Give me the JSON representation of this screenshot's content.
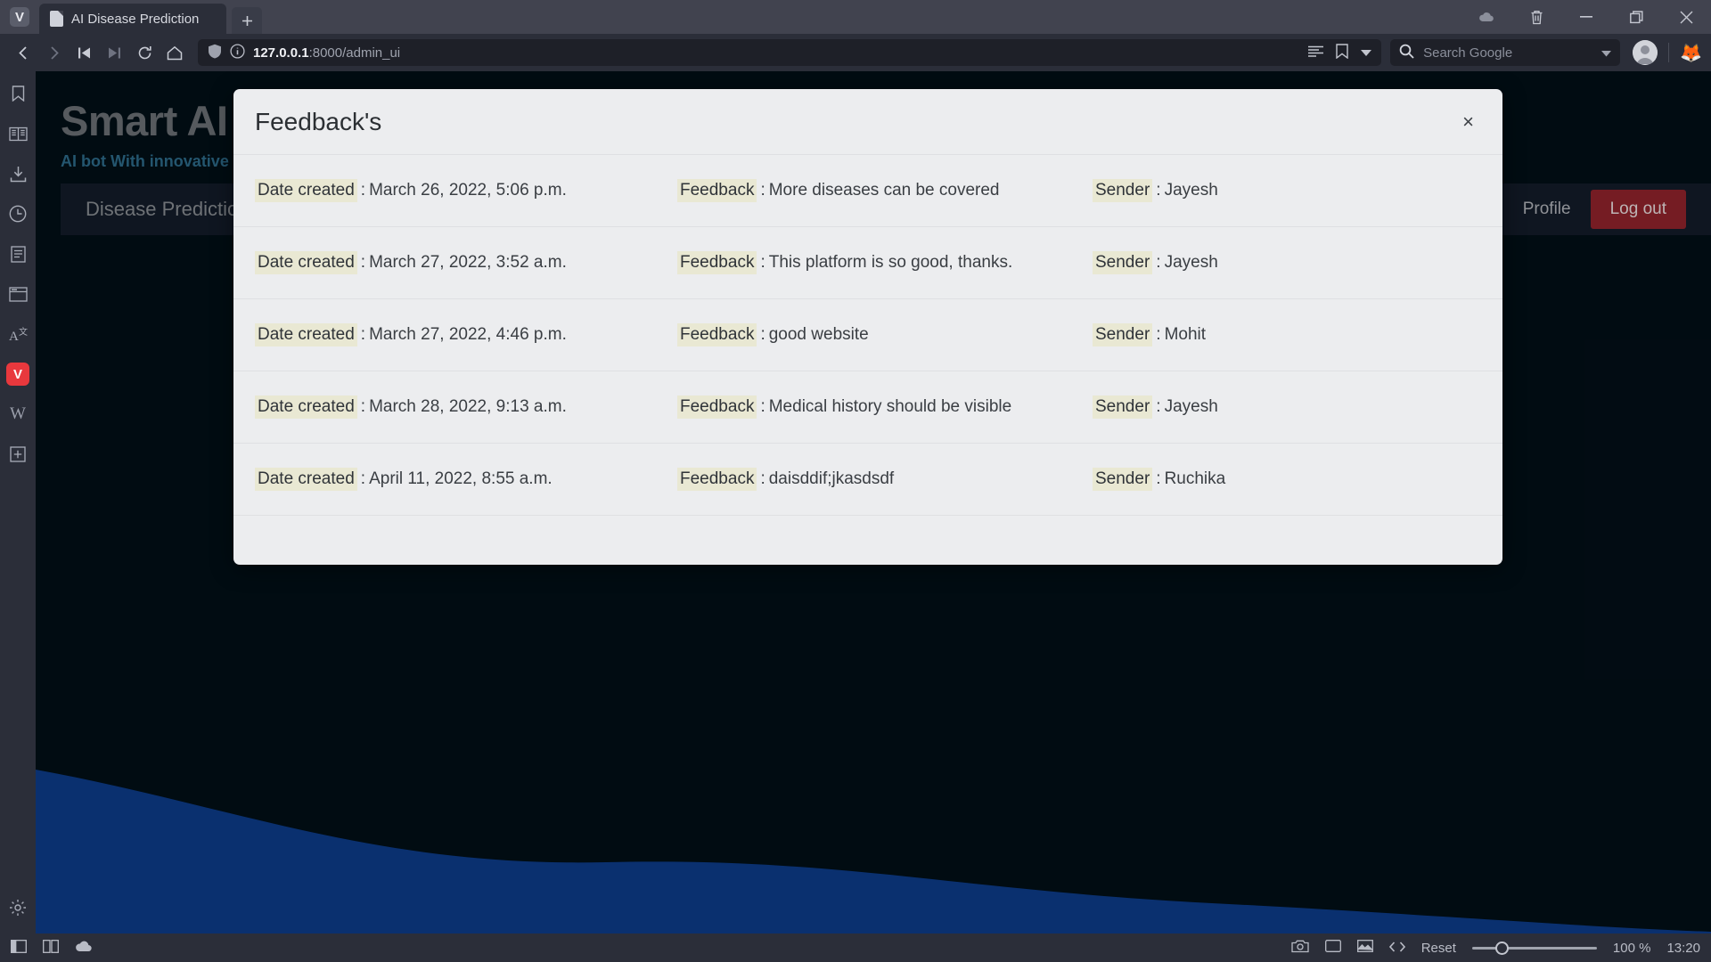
{
  "browser": {
    "app_icon": "vivaldi-logo",
    "tab": {
      "title": "AI Disease Prediction",
      "favicon": "page-icon"
    },
    "new_tab_label": "+",
    "window_controls": {
      "cloud": "cloud-icon",
      "trash": "trash-icon",
      "minimize": "minimize-icon",
      "maximize": "maximize-icon",
      "close": "close-icon"
    },
    "nav": {
      "back": "back-icon",
      "forward": "forward-icon",
      "rewind": "rewind-icon",
      "fastforward": "fastforward-icon",
      "reload": "reload-icon",
      "home": "home-icon"
    },
    "url": {
      "host": "127.0.0.1",
      "rest": ":8000/admin_ui",
      "shield": "shield-icon",
      "info": "info-icon"
    },
    "url_actions": {
      "reader": "reader-view-icon",
      "bookmark": "bookmark-icon",
      "chevron": "chevron-down-icon"
    },
    "search": {
      "placeholder": "Search Google",
      "icon": "search-icon",
      "chevron": "chevron-down-icon"
    },
    "extension": "firefox-metamask-icon"
  },
  "sidebar": {
    "items": [
      {
        "name": "bookmarks",
        "icon": "bookmark-icon"
      },
      {
        "name": "reading-list",
        "icon": "book-icon"
      },
      {
        "name": "downloads",
        "icon": "download-icon"
      },
      {
        "name": "history",
        "icon": "clock-icon"
      },
      {
        "name": "notes",
        "icon": "notes-icon"
      },
      {
        "name": "window-panel",
        "icon": "window-icon"
      },
      {
        "name": "translate",
        "icon": "translate-icon"
      },
      {
        "name": "vivaldi-panel",
        "icon": "vivaldi-icon",
        "label": "V",
        "active": true
      },
      {
        "name": "wikipedia-panel",
        "icon": "wikipedia-icon",
        "label": "W"
      },
      {
        "name": "add-panel",
        "icon": "plus-icon"
      }
    ],
    "settings": {
      "name": "settings",
      "icon": "gear-icon"
    }
  },
  "page": {
    "hero_title": "Smart AI",
    "hero_subtitle": "AI bot With innovative",
    "nav_link": "Disease Prediction",
    "profile_link": "Profile",
    "logout_label": "Log out",
    "wave_color": "#0d3e8f",
    "bg_color": "#021018"
  },
  "modal": {
    "title": "Feedback's",
    "close_label": "×",
    "labels": {
      "date": "Date created",
      "feedback": "Feedback",
      "sender": "Sender"
    },
    "separator": ":",
    "highlight_color": "#e9e8d3",
    "rows": [
      {
        "date": "March 26, 2022, 5:06 p.m.",
        "feedback": "More diseases can be covered",
        "sender": "Jayesh"
      },
      {
        "date": "March 27, 2022, 3:52 a.m.",
        "feedback": "This platform is so good, thanks.",
        "sender": "Jayesh"
      },
      {
        "date": "March 27, 2022, 4:46 p.m.",
        "feedback": "good website",
        "sender": "Mohit"
      },
      {
        "date": "March 28, 2022, 9:13 a.m.",
        "feedback": "Medical history should be visible",
        "sender": "Jayesh"
      },
      {
        "date": "April 11, 2022, 8:55 a.m.",
        "feedback": "daisddif;jkasdsdf",
        "sender": "Ruchika"
      }
    ]
  },
  "taskbar": {
    "left": [
      {
        "name": "panel-toggle",
        "icon": "panel-icon"
      },
      {
        "name": "tiling-toggle",
        "icon": "tile-icon"
      },
      {
        "name": "sync-status",
        "icon": "cloud-icon"
      }
    ],
    "right": [
      {
        "name": "capture-page",
        "icon": "camera-icon"
      },
      {
        "name": "page-actions",
        "icon": "rect-icon"
      },
      {
        "name": "image-toggle",
        "icon": "image-icon"
      },
      {
        "name": "developer-tools",
        "icon": "code-icon"
      }
    ],
    "reset_label": "Reset",
    "zoom_level": "100 %",
    "clock": "13:20"
  }
}
